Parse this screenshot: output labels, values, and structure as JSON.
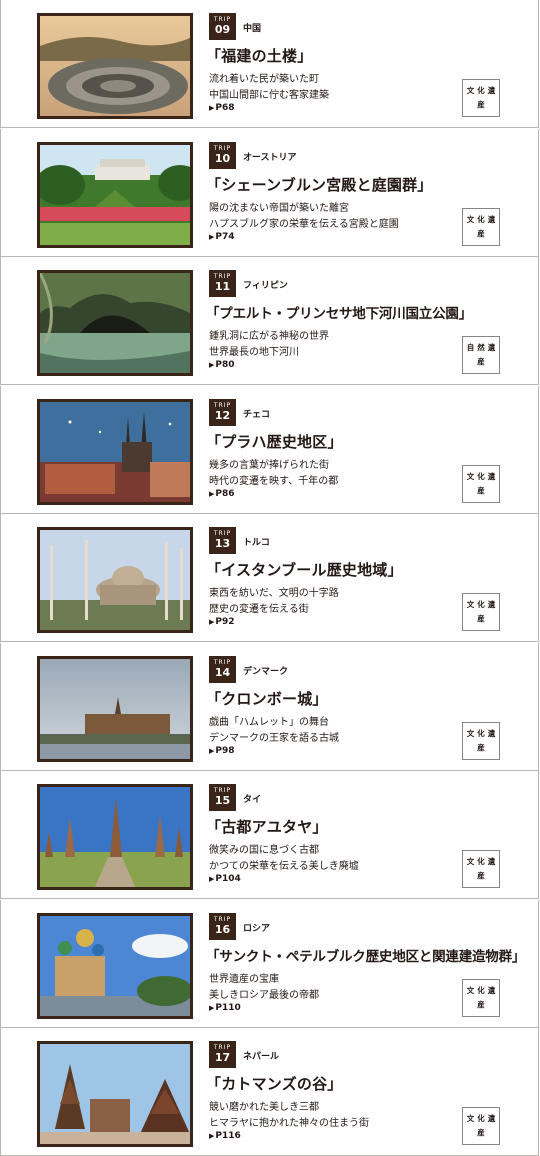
{
  "badge_label": "TRIP",
  "entries": [
    {
      "number": "09",
      "country": "中国",
      "title": "「福建の土楼」",
      "desc1": "流れ着いた民が築いた町",
      "desc2": "中国山間部に佇む客家建築",
      "page": "P68",
      "category": "文化遺産",
      "photo": "tulou-photo"
    },
    {
      "number": "10",
      "country": "オーストリア",
      "title": "「シェーンブルン宮殿と庭園群」",
      "desc1": "陽の沈まない帝国が築いた離宮",
      "desc2": "ハプスブルグ家の栄華を伝える宮殿と庭園",
      "page": "P74",
      "category": "文化遺産",
      "photo": "palace-garden-photo"
    },
    {
      "number": "11",
      "country": "フィリピン",
      "title": "「プエルト・プリンセサ地下河川国立公園」",
      "desc1": "鍾乳洞に広がる神秘の世界",
      "desc2": "世界最長の地下河川",
      "page": "P80",
      "category": "自然遺産",
      "photo": "underground-river-photo"
    },
    {
      "number": "12",
      "country": "チェコ",
      "title": "「プラハ歴史地区」",
      "desc1": "幾多の言葉が捧げられた街",
      "desc2": "時代の変遷を映す、千年の都",
      "page": "P86",
      "category": "文化遺産",
      "photo": "prague-photo"
    },
    {
      "number": "13",
      "country": "トルコ",
      "title": "「イスタンブール歴史地域」",
      "desc1": "東西を紡いだ、文明の十字路",
      "desc2": "歴史の変遷を伝える街",
      "page": "P92",
      "category": "文化遺産",
      "photo": "istanbul-photo"
    },
    {
      "number": "14",
      "country": "デンマーク",
      "title": "「クロンボー城」",
      "desc1": "戯曲「ハムレット」の舞台",
      "desc2": "デンマークの王家を語る古城",
      "page": "P98",
      "category": "文化遺産",
      "photo": "kronborg-photo"
    },
    {
      "number": "15",
      "country": "タイ",
      "title": "「古都アユタヤ」",
      "desc1": "微笑みの国に息づく古都",
      "desc2": "かつての栄華を伝える美しき廃墟",
      "page": "P104",
      "category": "文化遺産",
      "photo": "ayutthaya-photo"
    },
    {
      "number": "16",
      "country": "ロシア",
      "title": "「サンクト・ペテルブルク歴史地区と関連建造物群」",
      "desc1": "世界遺産の宝庫",
      "desc2": "美しきロシア最後の帝都",
      "page": "P110",
      "category": "文化遺産",
      "photo": "st-petersburg-photo"
    },
    {
      "number": "17",
      "country": "ネパール",
      "title": "「カトマンズの谷」",
      "desc1": "競い磨かれた美しき三都",
      "desc2": "ヒマラヤに抱かれた神々の住まう街",
      "page": "P116",
      "category": "文化遺産",
      "photo": "kathmandu-photo"
    }
  ]
}
